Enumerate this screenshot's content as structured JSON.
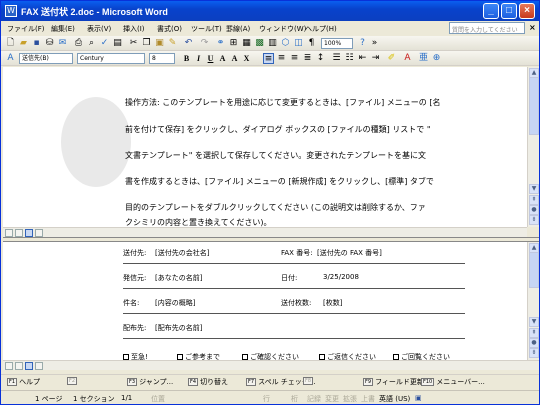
{
  "window": {
    "title": "FAX 送付状 2.doc - Microsoft Word",
    "app_icon": "W"
  },
  "menu": {
    "items": [
      "ファイル(F)",
      "編集(E)",
      "表示(V)",
      "挿入(I)",
      "書式(O)",
      "ツール(T)",
      "罫線(A)",
      "ウィンドウ(W)",
      "ヘルプ(H)"
    ],
    "help_placeholder": "質問を入力してください",
    "close": "×"
  },
  "toolbar1": {
    "zoom": "100%",
    "more": "»"
  },
  "toolbar2": {
    "style": "送信先(B)",
    "font": "Century",
    "size": "8"
  },
  "doc_top": {
    "lines": [
      "操作方法: このテンプレートを用途に応じて変更するときは、[ファイル] メニューの [名",
      "前を付けて保存] をクリックし、ダイアログ ボックスの [ファイルの種類] リストで \"",
      "文書テンプレート\" を選択して保存してください。変更されたテンプレートを基に文",
      "書を作成するときは、[ファイル] メニューの [新規作成] をクリックし、[標準] タブで",
      "目的のテンプレートをダブルクリックしてください (この説明文は削除するか、ファ",
      "クシミリの内容と置き換えてください)。"
    ]
  },
  "fax": {
    "to_label": "送付先:",
    "to_value": "[送付先の会社名]",
    "fax_label": "FAX 番号:",
    "fax_value": "[送付先の FAX 番号]",
    "from_label": "発信元:",
    "from_value": "[あなたの名前]",
    "date_label": "日付:",
    "date_value": "3/25/2008",
    "subject_label": "件名:",
    "subject_value": "[内容の概略]",
    "pages_label": "送付枚数:",
    "pages_value": "[枚数]",
    "cc_label": "配布先:",
    "cc_value": "[配布先の名前]",
    "checkboxes": [
      "至急!",
      "ご参考まで",
      "ご確認ください",
      "ご返信ください",
      "ご回覧ください"
    ]
  },
  "fkeys": [
    {
      "key": "F1",
      "label": "ヘルプ"
    },
    {
      "key": "F2",
      "label": ""
    },
    {
      "key": "F3",
      "label": "ジャンプ..."
    },
    {
      "key": "F4",
      "label": "切り替え"
    },
    {
      "key": "F7",
      "label": "スペル チェック..."
    },
    {
      "key": "F8",
      "label": ""
    },
    {
      "key": "F9",
      "label": "フィールド更新"
    },
    {
      "key": "F10",
      "label": "メニューバー..."
    }
  ],
  "status": {
    "page": "1 ページ",
    "section": "1 セクション",
    "pages": "1/1",
    "position": "位置",
    "line": "行",
    "column": "桁",
    "rec": "記録",
    "trk": "変更",
    "ext": "拡張",
    "ovr": "上書",
    "language": "英語 (US)"
  }
}
